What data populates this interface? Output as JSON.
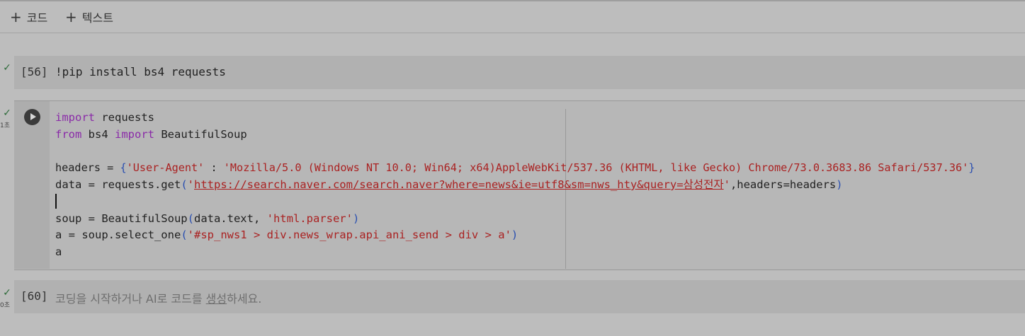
{
  "toolbar": {
    "add_code_label": "코드",
    "add_text_label": "텍스트",
    "plus_glyph": "+"
  },
  "cells": [
    {
      "status_icon": "✓",
      "exec_count": "[56]",
      "code": "!pip install bs4 requests"
    },
    {
      "status_icon": "✓",
      "time": "1초",
      "lines": {
        "l1_kw": "import",
        "l1_rest": " requests",
        "l2_kw1": "from",
        "l2_mid": " bs4 ",
        "l2_kw2": "import",
        "l2_rest": " BeautifulSoup",
        "l4_a": "headers = ",
        "l4_b": "{",
        "l4_c": "'User-Agent'",
        "l4_d": " : ",
        "l4_e": "'Mozilla/5.0 (Windows NT 10.0; Win64; x64)AppleWebKit/537.36 (KHTML, like Gecko) Chrome/73.0.3683.86 Safari/537.36'",
        "l4_f": "}",
        "l5_a": "data = requests.get",
        "l5_b": "(",
        "l5_c": "'",
        "l5_url": "https://search.naver.com/search.naver?where=news&ie=utf8&sm=nws_hty&query=삼성전자",
        "l5_d": "'",
        "l5_e": ",headers=headers",
        "l5_f": ")",
        "l7_a": "soup = BeautifulSoup",
        "l7_b": "(",
        "l7_c": "data.text, ",
        "l7_d": "'html.parser'",
        "l7_e": ")",
        "l8_a": "a = soup.select_one",
        "l8_b": "(",
        "l8_c": "'#sp_nws1 > div.news_wrap.api_ani_send > div > a'",
        "l8_d": ")",
        "l9": "a"
      }
    },
    {
      "status_icon": "✓",
      "time": "0초",
      "exec_count": "[60]",
      "placeholder_a": "코딩을 시작하거나 AI로 코드를 ",
      "placeholder_link": "생성",
      "placeholder_b": "하세요."
    }
  ]
}
